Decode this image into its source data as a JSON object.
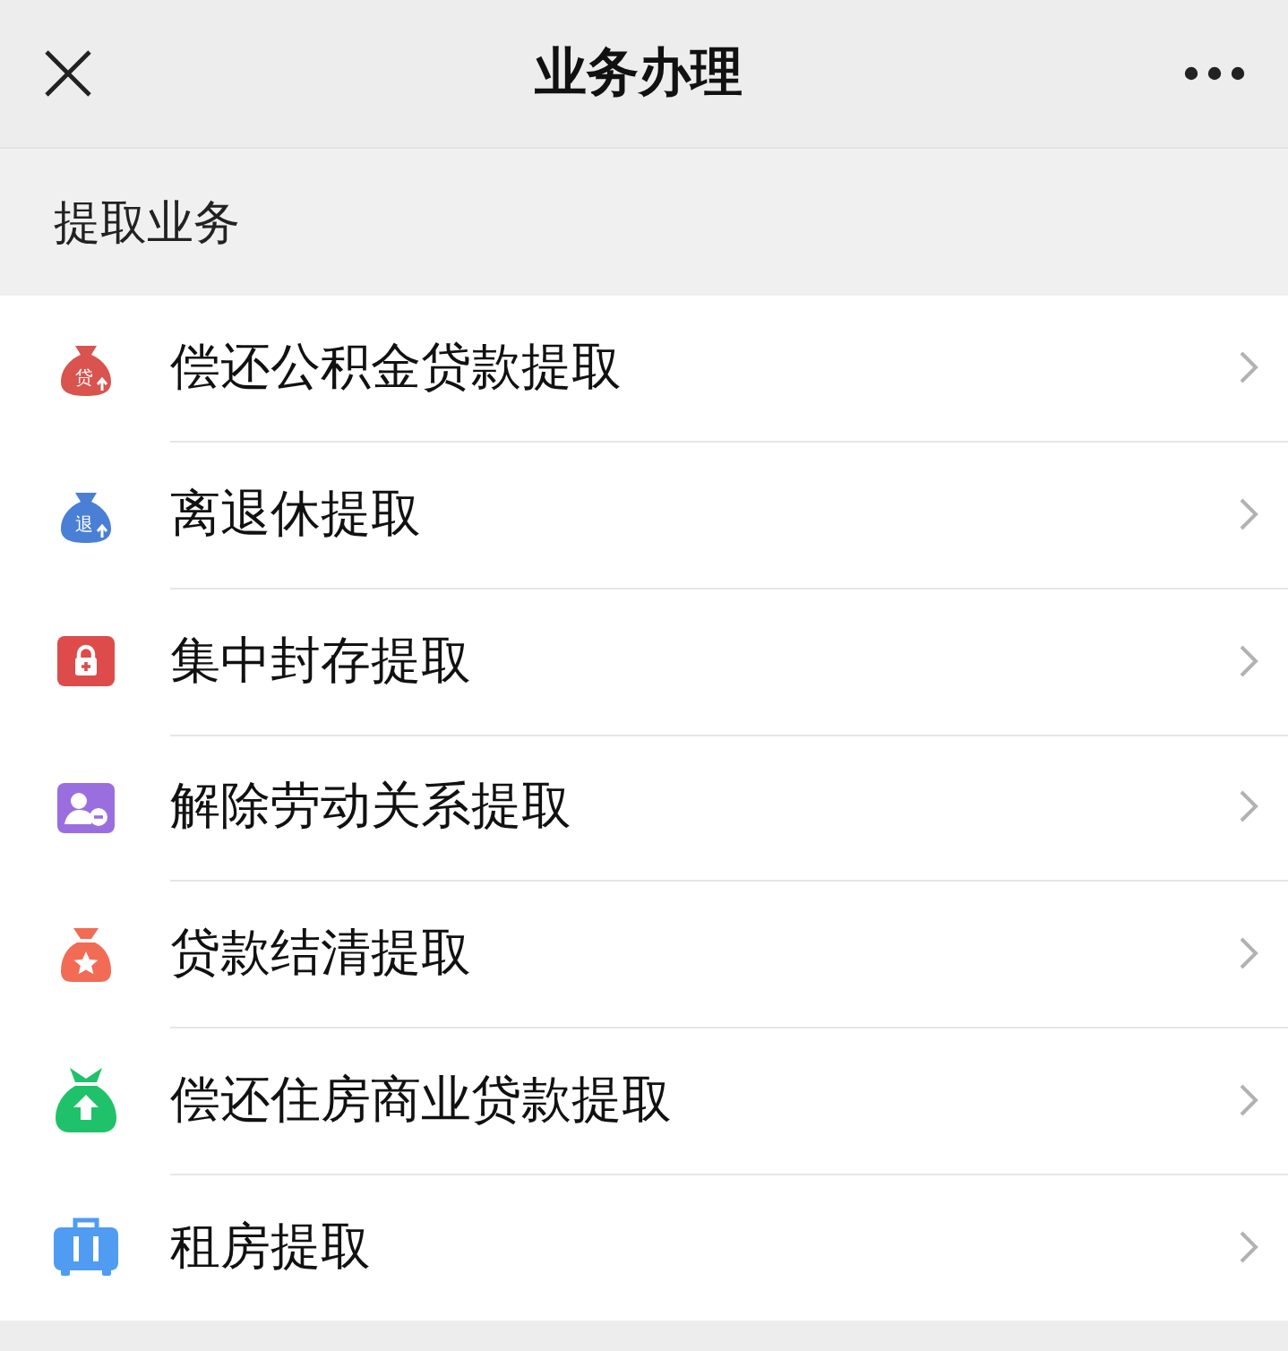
{
  "window": {
    "title": "业务办理"
  },
  "section": {
    "title": "提取业务"
  },
  "items": [
    {
      "label": "偿还公积金贷款提取",
      "icon": {
        "kind": "bag",
        "color": "#d9534f",
        "text": "贷"
      }
    },
    {
      "label": "离退休提取",
      "icon": {
        "kind": "bag",
        "color": "#4a7fd6",
        "text": "退"
      }
    },
    {
      "label": "集中封存提取",
      "icon": {
        "kind": "lock",
        "color": "#de4b4b"
      }
    },
    {
      "label": "解除劳动关系提取",
      "icon": {
        "kind": "person",
        "color": "#9b6ee0"
      }
    },
    {
      "label": "贷款结清提取",
      "icon": {
        "kind": "star-bag",
        "color": "#f26b55"
      }
    },
    {
      "label": "偿还住房商业贷款提取",
      "icon": {
        "kind": "up-bag",
        "color": "#1fc16b"
      }
    },
    {
      "label": "租房提取",
      "icon": {
        "kind": "suitcase",
        "color": "#4f9cf2"
      }
    }
  ]
}
